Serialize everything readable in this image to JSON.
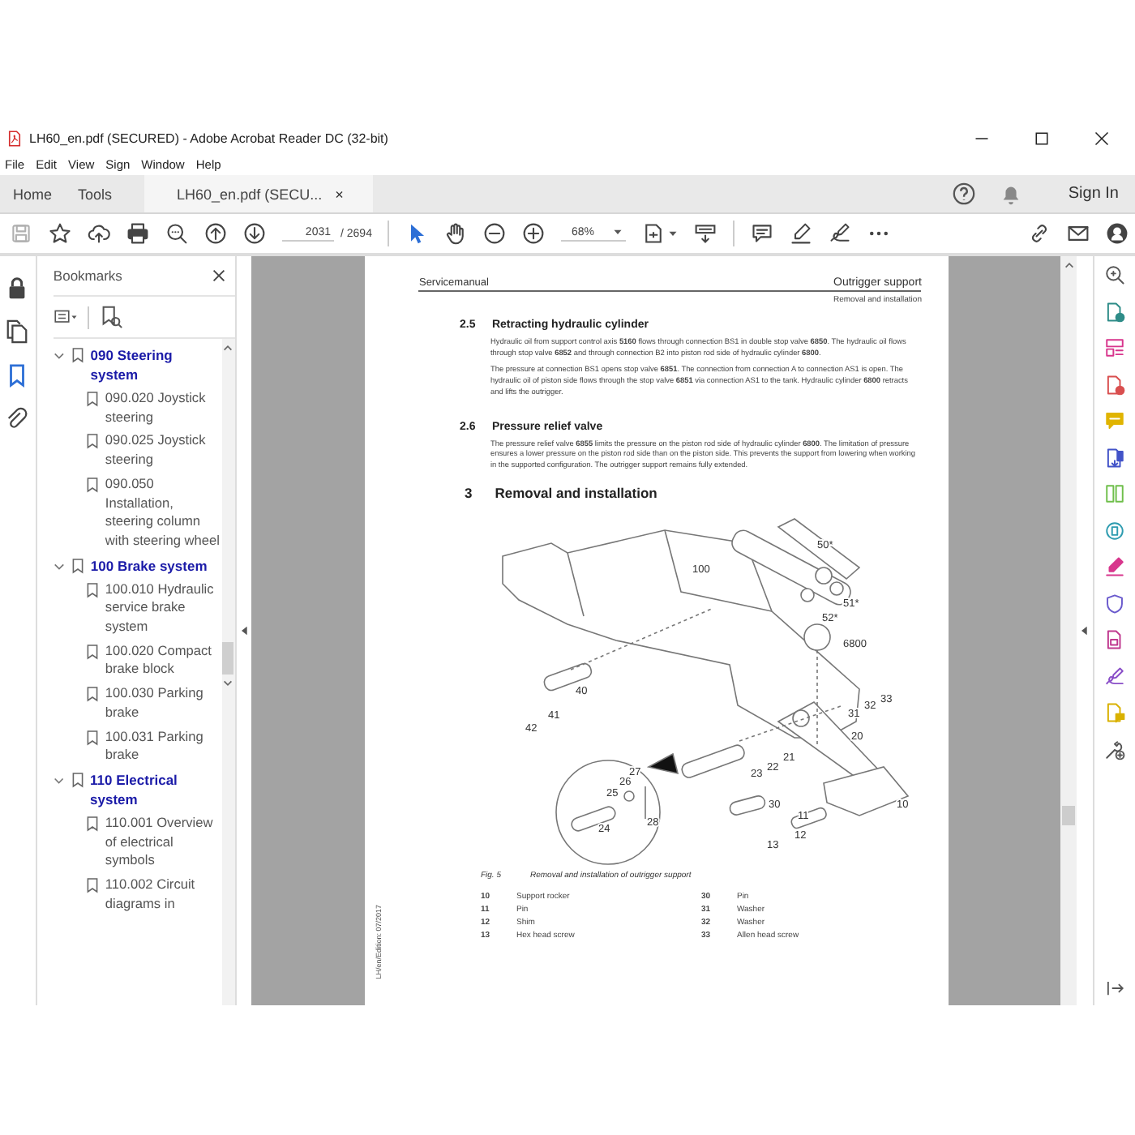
{
  "window": {
    "title": "LH60_en.pdf (SECURED) - Adobe Acrobat Reader DC (32-bit)"
  },
  "menu": [
    "File",
    "Edit",
    "View",
    "Sign",
    "Window",
    "Help"
  ],
  "tabs": [
    {
      "label": "Home",
      "selected": false
    },
    {
      "label": "Tools",
      "selected": false
    },
    {
      "label": "LH60_en.pdf (SECU...",
      "selected": true
    }
  ],
  "close_tab_glyph": "×",
  "sign_in": "Sign In",
  "toolbar": {
    "page": "2031",
    "page_total": "/ 2694",
    "zoom": "68%"
  },
  "bookmarks": {
    "title": "Bookmarks",
    "items": [
      {
        "label": "090 Steering system",
        "expanded": true,
        "children": [
          {
            "label": "090.020 Joystick steering"
          },
          {
            "label": "090.025 Joystick steering"
          },
          {
            "label": "090.050 Installation, steering column with steering wheel"
          }
        ]
      },
      {
        "label": "100 Brake system",
        "expanded": true,
        "children": [
          {
            "label": "100.010 Hydraulic service brake system"
          },
          {
            "label": "100.020 Compact brake block"
          },
          {
            "label": "100.030 Parking brake"
          },
          {
            "label": "100.031 Parking brake"
          }
        ]
      },
      {
        "label": "110 Electrical system",
        "expanded": true,
        "children": [
          {
            "label": "110.001 Overview of electrical symbols"
          },
          {
            "label": "110.002 Circuit diagrams in"
          }
        ]
      }
    ]
  },
  "document": {
    "header_left": "Servicemanual",
    "header_right": "Outrigger support",
    "header_sub": "Removal and installation",
    "sections": [
      {
        "number": "2.5",
        "title": "Retracting hydraulic cylinder",
        "paragraphs": [
          "Hydraulic oil from support control axis **5160** flows through connection BS1 in double stop valve **6850**. The hydraulic oil flows through stop valve **6852** and through connection B2 into piston rod side of hydraulic cylinder **6800**.",
          "The pressure at connection BS1 opens stop valve **6851**. The connection from connection A to connection AS1 is open. The hydraulic oil of piston side flows through the stop valve **6851** via connection AS1 to the tank. Hydraulic cylinder **6800** retracts and lifts the outrigger."
        ]
      },
      {
        "number": "2.6",
        "title": "Pressure relief valve",
        "paragraphs": [
          "The pressure relief valve **6855** limits the pressure on the piston rod side of hydraulic cylinder **6800**. The limitation of pressure ensures a lower pressure on the piston rod side than on the piston side. This prevents the support from lowering when working in the supported configuration. The outrigger support remains fully extended."
        ]
      }
    ],
    "chapter": {
      "number": "3",
      "title": "Removal and installation"
    },
    "figure_labels": [
      "100",
      "50*",
      "51*",
      "52*",
      "6800",
      "40",
      "41",
      "42",
      "31",
      "32",
      "33",
      "20",
      "21",
      "22",
      "23",
      "27",
      "26",
      "25",
      "24",
      "28",
      "30",
      "10",
      "11",
      "12",
      "13"
    ],
    "caption": {
      "number": "Fig. 5",
      "text": "Removal and installation of outrigger support"
    },
    "parts": [
      {
        "number": "10",
        "name": "Support rocker"
      },
      {
        "number": "11",
        "name": "Pin"
      },
      {
        "number": "12",
        "name": "Shim"
      },
      {
        "number": "13",
        "name": "Hex head screw"
      },
      {
        "number": "30",
        "name": "Pin"
      },
      {
        "number": "31",
        "name": "Washer"
      },
      {
        "number": "32",
        "name": "Washer"
      },
      {
        "number": "33",
        "name": "Allen head screw"
      }
    ],
    "side_note": "LH/en/Edition: 07/2017"
  }
}
